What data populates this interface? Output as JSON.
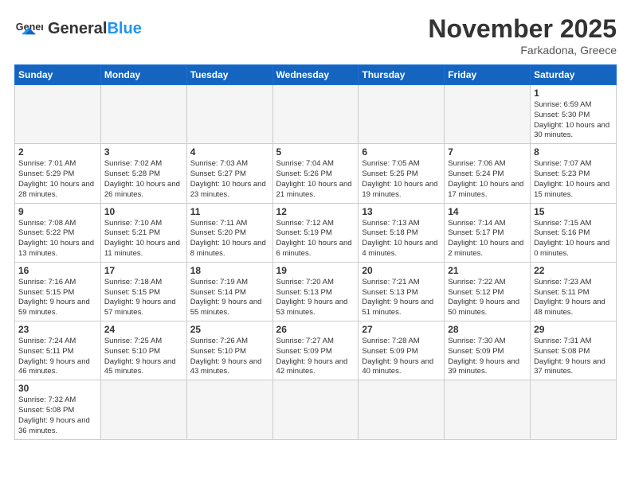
{
  "header": {
    "logo_general": "General",
    "logo_blue": "Blue",
    "month": "November 2025",
    "location": "Farkadona, Greece"
  },
  "weekdays": [
    "Sunday",
    "Monday",
    "Tuesday",
    "Wednesday",
    "Thursday",
    "Friday",
    "Saturday"
  ],
  "weeks": [
    [
      {
        "day": null
      },
      {
        "day": null
      },
      {
        "day": null
      },
      {
        "day": null
      },
      {
        "day": null
      },
      {
        "day": null
      },
      {
        "day": "1",
        "info": "Sunrise: 6:59 AM\nSunset: 5:30 PM\nDaylight: 10 hours and 30 minutes."
      }
    ],
    [
      {
        "day": "2",
        "info": "Sunrise: 7:01 AM\nSunset: 5:29 PM\nDaylight: 10 hours and 28 minutes."
      },
      {
        "day": "3",
        "info": "Sunrise: 7:02 AM\nSunset: 5:28 PM\nDaylight: 10 hours and 26 minutes."
      },
      {
        "day": "4",
        "info": "Sunrise: 7:03 AM\nSunset: 5:27 PM\nDaylight: 10 hours and 23 minutes."
      },
      {
        "day": "5",
        "info": "Sunrise: 7:04 AM\nSunset: 5:26 PM\nDaylight: 10 hours and 21 minutes."
      },
      {
        "day": "6",
        "info": "Sunrise: 7:05 AM\nSunset: 5:25 PM\nDaylight: 10 hours and 19 minutes."
      },
      {
        "day": "7",
        "info": "Sunrise: 7:06 AM\nSunset: 5:24 PM\nDaylight: 10 hours and 17 minutes."
      },
      {
        "day": "8",
        "info": "Sunrise: 7:07 AM\nSunset: 5:23 PM\nDaylight: 10 hours and 15 minutes."
      }
    ],
    [
      {
        "day": "9",
        "info": "Sunrise: 7:08 AM\nSunset: 5:22 PM\nDaylight: 10 hours and 13 minutes."
      },
      {
        "day": "10",
        "info": "Sunrise: 7:10 AM\nSunset: 5:21 PM\nDaylight: 10 hours and 11 minutes."
      },
      {
        "day": "11",
        "info": "Sunrise: 7:11 AM\nSunset: 5:20 PM\nDaylight: 10 hours and 8 minutes."
      },
      {
        "day": "12",
        "info": "Sunrise: 7:12 AM\nSunset: 5:19 PM\nDaylight: 10 hours and 6 minutes."
      },
      {
        "day": "13",
        "info": "Sunrise: 7:13 AM\nSunset: 5:18 PM\nDaylight: 10 hours and 4 minutes."
      },
      {
        "day": "14",
        "info": "Sunrise: 7:14 AM\nSunset: 5:17 PM\nDaylight: 10 hours and 2 minutes."
      },
      {
        "day": "15",
        "info": "Sunrise: 7:15 AM\nSunset: 5:16 PM\nDaylight: 10 hours and 0 minutes."
      }
    ],
    [
      {
        "day": "16",
        "info": "Sunrise: 7:16 AM\nSunset: 5:15 PM\nDaylight: 9 hours and 59 minutes."
      },
      {
        "day": "17",
        "info": "Sunrise: 7:18 AM\nSunset: 5:15 PM\nDaylight: 9 hours and 57 minutes."
      },
      {
        "day": "18",
        "info": "Sunrise: 7:19 AM\nSunset: 5:14 PM\nDaylight: 9 hours and 55 minutes."
      },
      {
        "day": "19",
        "info": "Sunrise: 7:20 AM\nSunset: 5:13 PM\nDaylight: 9 hours and 53 minutes."
      },
      {
        "day": "20",
        "info": "Sunrise: 7:21 AM\nSunset: 5:13 PM\nDaylight: 9 hours and 51 minutes."
      },
      {
        "day": "21",
        "info": "Sunrise: 7:22 AM\nSunset: 5:12 PM\nDaylight: 9 hours and 50 minutes."
      },
      {
        "day": "22",
        "info": "Sunrise: 7:23 AM\nSunset: 5:11 PM\nDaylight: 9 hours and 48 minutes."
      }
    ],
    [
      {
        "day": "23",
        "info": "Sunrise: 7:24 AM\nSunset: 5:11 PM\nDaylight: 9 hours and 46 minutes."
      },
      {
        "day": "24",
        "info": "Sunrise: 7:25 AM\nSunset: 5:10 PM\nDaylight: 9 hours and 45 minutes."
      },
      {
        "day": "25",
        "info": "Sunrise: 7:26 AM\nSunset: 5:10 PM\nDaylight: 9 hours and 43 minutes."
      },
      {
        "day": "26",
        "info": "Sunrise: 7:27 AM\nSunset: 5:09 PM\nDaylight: 9 hours and 42 minutes."
      },
      {
        "day": "27",
        "info": "Sunrise: 7:28 AM\nSunset: 5:09 PM\nDaylight: 9 hours and 40 minutes."
      },
      {
        "day": "28",
        "info": "Sunrise: 7:30 AM\nSunset: 5:09 PM\nDaylight: 9 hours and 39 minutes."
      },
      {
        "day": "29",
        "info": "Sunrise: 7:31 AM\nSunset: 5:08 PM\nDaylight: 9 hours and 37 minutes."
      }
    ],
    [
      {
        "day": "30",
        "info": "Sunrise: 7:32 AM\nSunset: 5:08 PM\nDaylight: 9 hours and 36 minutes."
      },
      {
        "day": null
      },
      {
        "day": null
      },
      {
        "day": null
      },
      {
        "day": null
      },
      {
        "day": null
      },
      {
        "day": null
      }
    ]
  ]
}
